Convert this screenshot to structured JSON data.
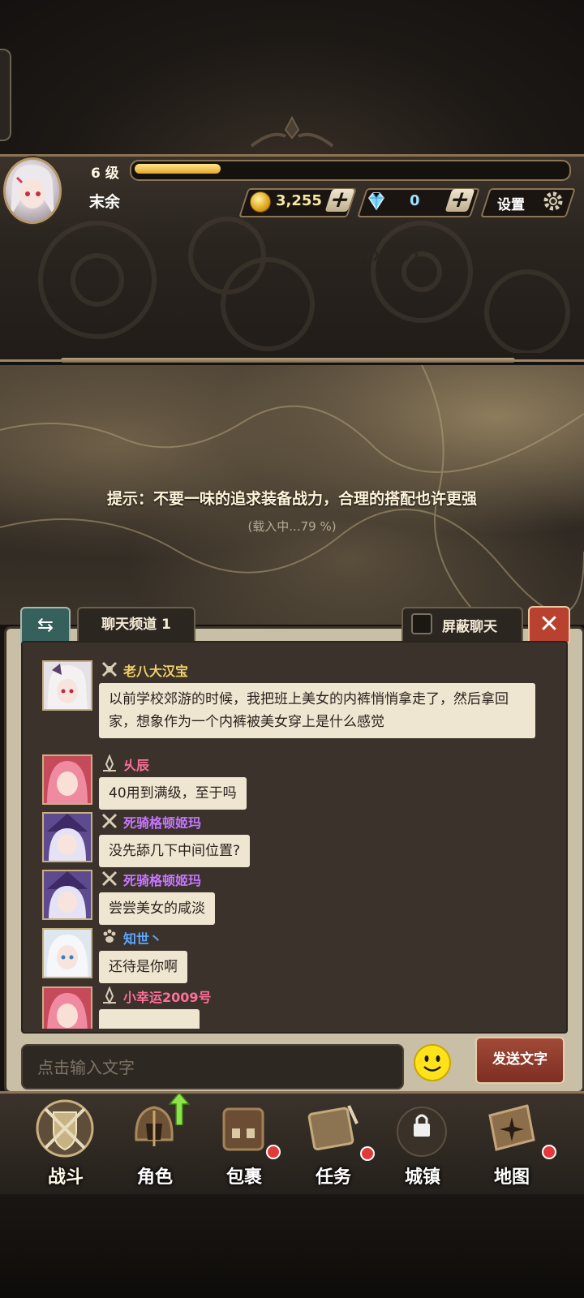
{
  "player": {
    "level_label": "6 级",
    "xp_fraction": 0.2,
    "name": "末余"
  },
  "currency": {
    "coins": "3,255",
    "diamonds": "0",
    "coin_icon": "gold-coin-icon",
    "diamond_icon": "diamond-icon"
  },
  "settings": {
    "label": "设置"
  },
  "loading": {
    "tip": "提示：不要一味的追求装备战力，合理的搭配也许更强",
    "status": "(载入中...79 %)",
    "progress_percent": 79
  },
  "chat": {
    "channel_label": "聊天频道 1",
    "block_label": "屏蔽聊天",
    "messages": [
      {
        "name": "老八大汉宝",
        "name_color": "#f2d06a",
        "text": "以前学校郊游的时候，我把班上美女的内裤悄悄拿走了，然后拿回家，想象作为一个内裤被美女穿上是什么感觉"
      },
      {
        "name": "乆辰",
        "name_color": "#ff6f9a",
        "text": "40用到满级，至于吗"
      },
      {
        "name": "死骑格顿姬玛",
        "name_color": "#c777ff",
        "text": "没先舔几下中间位置?"
      },
      {
        "name": "死骑格顿姬玛",
        "name_color": "#c777ff",
        "text": "尝尝美女的咸淡"
      },
      {
        "name": "知世丶",
        "name_color": "#5aa8ff",
        "text": "还待是你啊"
      },
      {
        "name": "小幸运2009号",
        "name_color": "#ff6f9a",
        "text": ""
      }
    ],
    "input_placeholder": "点击输入文字",
    "send_label": "发送文字"
  },
  "nav": {
    "items": [
      {
        "label": "战斗",
        "icon": "battle-shield-icon"
      },
      {
        "label": "角色",
        "icon": "character-helmet-icon"
      },
      {
        "label": "包裹",
        "icon": "backpack-icon"
      },
      {
        "label": "任务",
        "icon": "quest-scroll-icon"
      },
      {
        "label": "城镇",
        "icon": "town-locked-icon"
      },
      {
        "label": "地图",
        "icon": "map-compass-icon"
      }
    ]
  },
  "colors": {
    "gold": "#f2d06a",
    "panel": "#3a322b",
    "bubble": "#efe6d2",
    "accent_red": "#b8412f",
    "tab_teal": "#35605b"
  }
}
